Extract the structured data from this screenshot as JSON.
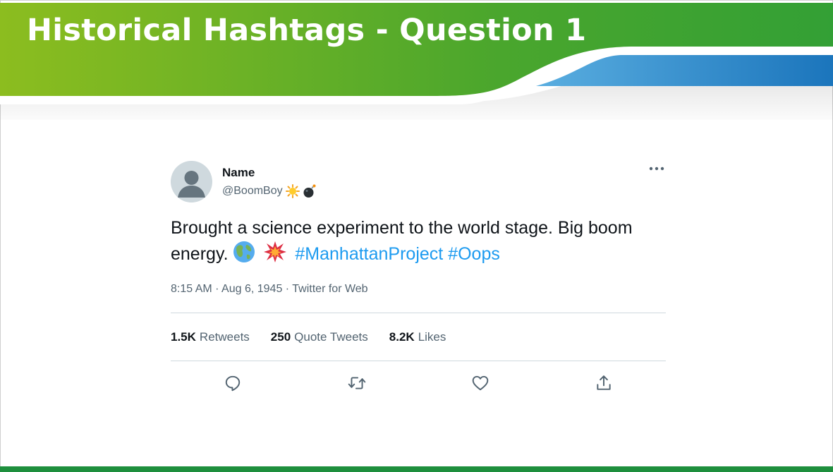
{
  "slide": {
    "title": "Historical Hashtags - Question 1",
    "colors": {
      "green": "#4aa62d",
      "blue": "#1b75bc",
      "bottom_bar": "#1e8f3d"
    }
  },
  "tweet": {
    "author_name": "Name",
    "handle": "@BoomBoy",
    "handle_badges": [
      "sun-icon",
      "bomb-icon"
    ],
    "text": "Brought a science experiment to the world stage. Big boom energy.",
    "emojis": [
      "globe-icon",
      "collision-icon"
    ],
    "hashtags": [
      "#ManhattanProject",
      "#Oops"
    ],
    "time": "8:15 AM",
    "date": "Aug 6, 1945",
    "source": "Twitter for Web",
    "separator": "·",
    "stats": {
      "retweets_count": "1.5K",
      "retweets_label": "Retweets",
      "quotes_count": "250",
      "quotes_label": "Quote Tweets",
      "likes_count": "8.2K",
      "likes_label": "Likes"
    },
    "actions": [
      "reply-icon",
      "retweet-icon",
      "like-icon",
      "share-icon"
    ],
    "colors": {
      "text": "#0f1419",
      "muted": "#536471",
      "link": "#1d9bf0",
      "divider": "#cfd9de"
    }
  }
}
